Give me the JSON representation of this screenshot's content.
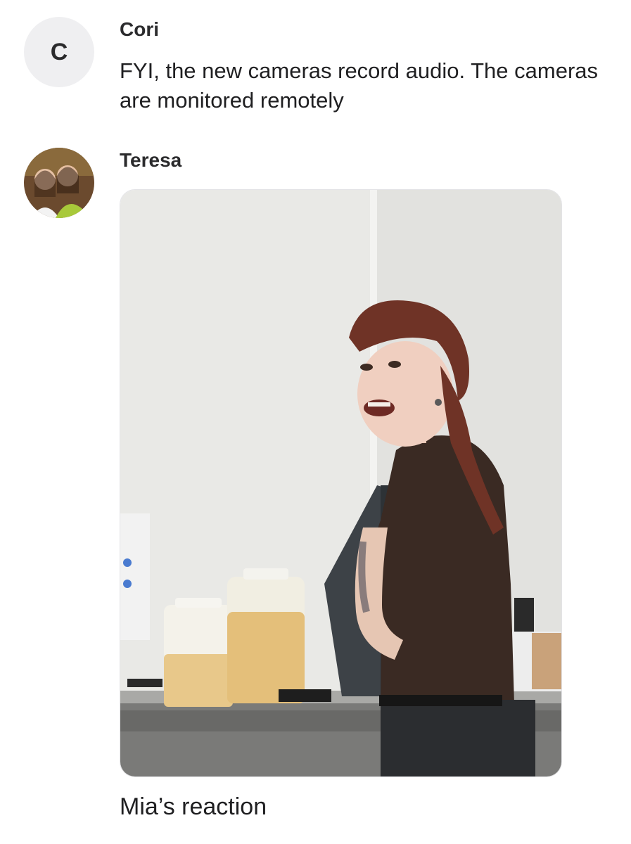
{
  "messages": [
    {
      "sender": "Cori",
      "avatar_letter": "C",
      "text": "FYI, the new cameras record audio. The cameras are monitored remotely"
    },
    {
      "sender": "Teresa",
      "avatar": "profile-photo",
      "attachment": "photo",
      "caption": "Mia’s reaction"
    }
  ]
}
